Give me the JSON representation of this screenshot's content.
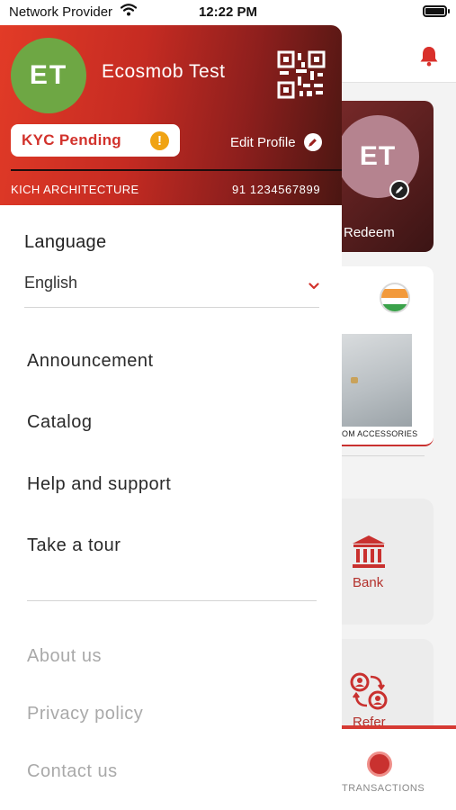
{
  "status_bar": {
    "carrier": "Network Provider",
    "time": "12:22 PM"
  },
  "background_app": {
    "avatar_initials": "ET",
    "redeem_label": "Redeem",
    "product_label": "OM ACCESSORIES",
    "bank_label": "Bank",
    "refer_label": "Refer",
    "tab_transactions_label": "TRANSACTIONS"
  },
  "drawer": {
    "avatar_initials": "ET",
    "user_name": "Ecosmob Test",
    "kyc_status": "KYC Pending",
    "kyc_alert_symbol": "!",
    "edit_profile_label": "Edit Profile",
    "company": "KICH ARCHITECTURE",
    "phone": "91 1234567899",
    "language_label": "Language",
    "language_value": "English",
    "menu_items": [
      "Announcement",
      "Catalog",
      "Help and support",
      "Take a tour"
    ],
    "secondary_items": [
      "About us",
      "Privacy policy",
      "Contact us"
    ]
  },
  "colors": {
    "brand_red": "#d2322c",
    "avatar_green": "#6ea744",
    "alert_orange": "#f0a313",
    "muted_text": "#a9a9a9"
  }
}
